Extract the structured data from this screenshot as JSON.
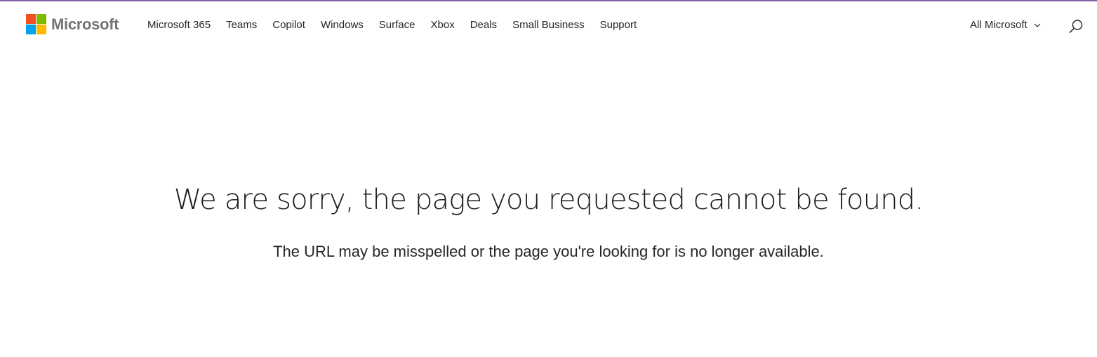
{
  "brand": {
    "name": "Microsoft",
    "logo_colors": [
      "#f25022",
      "#7fba00",
      "#00a4ef",
      "#ffb900"
    ],
    "accent_bar_color": "#8064a2"
  },
  "nav": {
    "items": [
      {
        "label": "Microsoft 365"
      },
      {
        "label": "Teams"
      },
      {
        "label": "Copilot"
      },
      {
        "label": "Windows"
      },
      {
        "label": "Surface"
      },
      {
        "label": "Xbox"
      },
      {
        "label": "Deals"
      },
      {
        "label": "Small Business"
      },
      {
        "label": "Support"
      }
    ],
    "all_microsoft_label": "All Microsoft",
    "all_microsoft_icon": "chevron-down-icon",
    "search_icon": "search-icon"
  },
  "error": {
    "headline": "We are sorry, the page you requested cannot be found.",
    "message": "The URL may be misspelled or the page you're looking for is no longer available."
  }
}
